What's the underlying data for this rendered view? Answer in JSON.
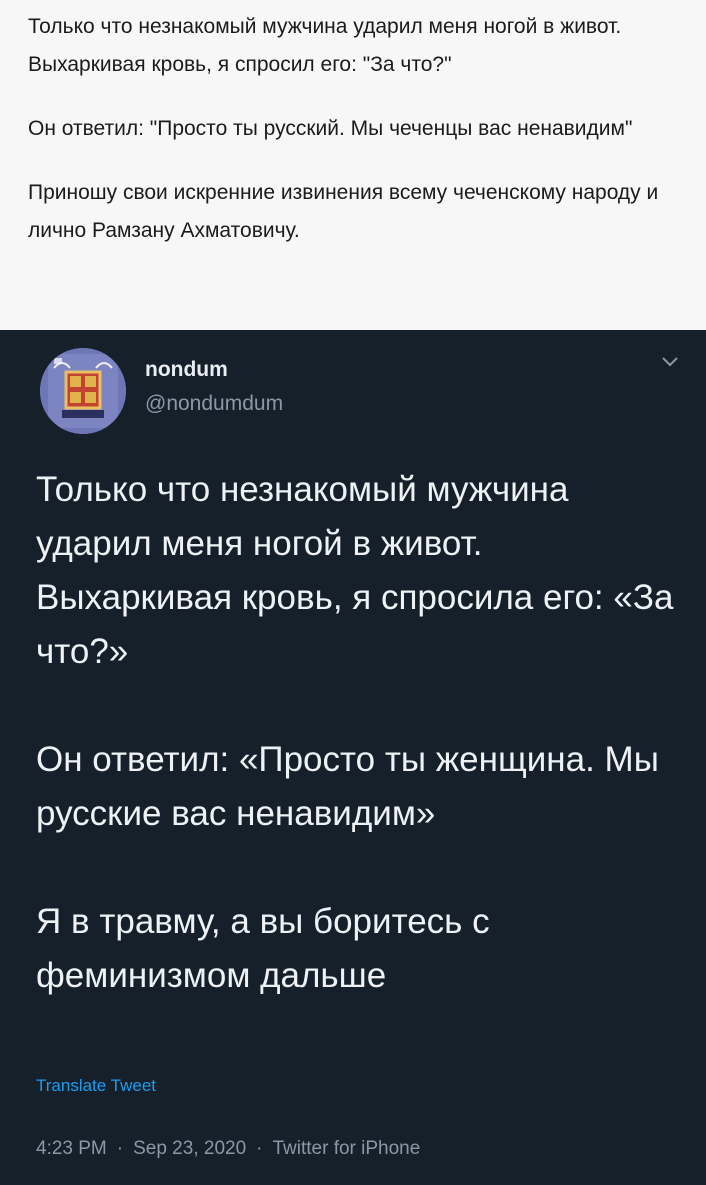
{
  "caption": {
    "paragraphs": [
      "Только что незнакомый мужчина ударил меня ногой в живот. Выхаркивая кровь, я спросил его: \"За что?\"",
      "Он ответил: \"Просто ты русский. Мы чеченцы вас ненавидим\"",
      "Приношу свои искренние извинения всему чеченскому народу и лично Рамзану Ахматовичу."
    ]
  },
  "tweet": {
    "display_name": "nondum",
    "handle": "@nondumdum",
    "paragraphs": [
      "Только что незнакомый мужчина ударил меня ногой в живот. Выхаркивая кровь, я спросила его: «За что?»",
      "Он ответил: «Просто ты женщина. Мы русские вас ненавидим»",
      "Я в травму, а вы боритесь с феминизмом дальше"
    ],
    "translate_label": "Translate Tweet",
    "time": "4:23 PM",
    "date": "Sep 23, 2020",
    "source": "Twitter for iPhone",
    "separator": "·"
  },
  "colors": {
    "tweet_background": "#15202b",
    "caption_background": "#f7f7f7",
    "link": "#1d9bf0",
    "muted": "#8b98a5"
  }
}
